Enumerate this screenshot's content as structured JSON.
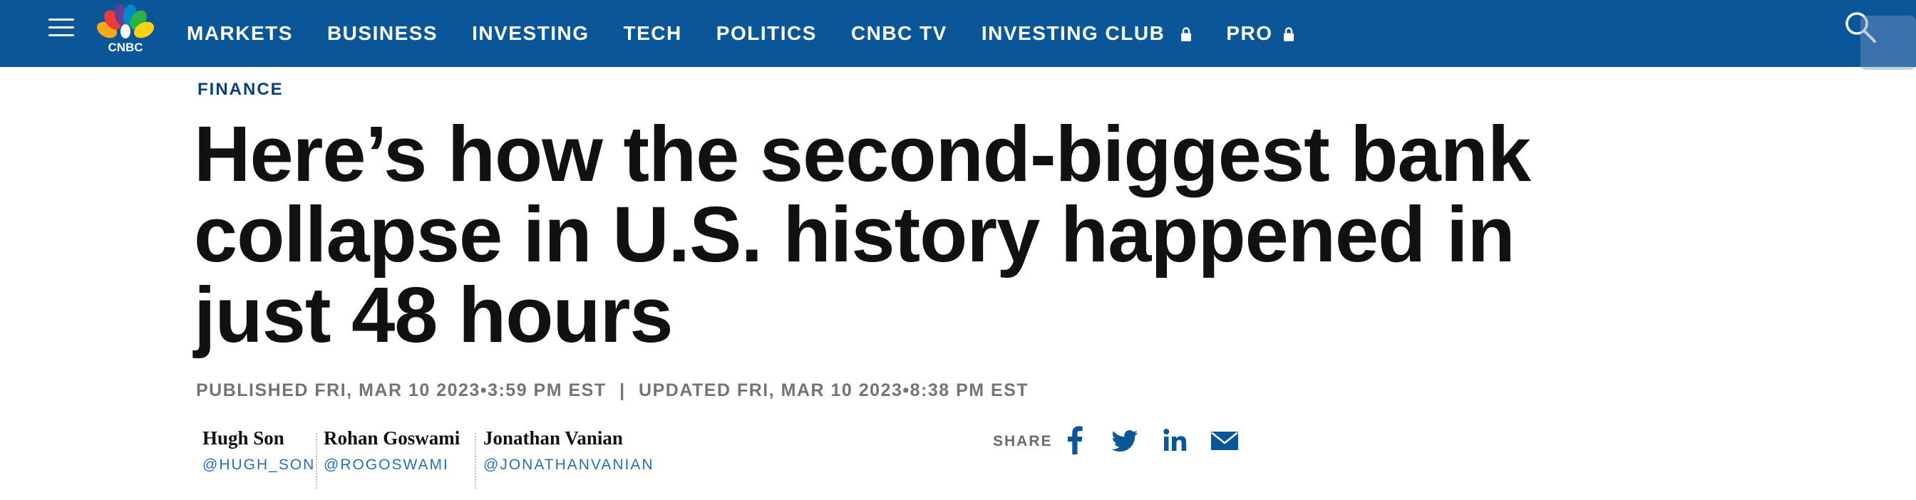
{
  "header": {
    "logo_text": "CNBC",
    "nav": [
      {
        "label": "MARKETS"
      },
      {
        "label": "BUSINESS"
      },
      {
        "label": "INVESTING"
      },
      {
        "label": "TECH"
      },
      {
        "label": "POLITICS"
      },
      {
        "label": "CNBC TV"
      },
      {
        "label": "INVESTING CLUB",
        "icon": "lock-icon"
      },
      {
        "label": "PRO",
        "icon": "lock-icon"
      }
    ],
    "search_icon": "search-icon",
    "menu_icon": "hamburger-menu-icon"
  },
  "article": {
    "section": "FINANCE",
    "headline": "Here’s how the second-biggest bank collapse in U.S. history happened in just 48 hours",
    "published": "PUBLISHED FRI, MAR 10 2023•3:59 PM EST",
    "separator": "|",
    "updated": "UPDATED FRI, MAR 10 2023•8:38 PM EST",
    "authors": [
      {
        "name": "Hugh Son",
        "handle": "@HUGH_SON"
      },
      {
        "name": "Rohan Goswami",
        "handle": "@ROGOSWAMI"
      },
      {
        "name": "Jonathan Vanian",
        "handle": "@JONATHANVANIAN"
      }
    ]
  },
  "share": {
    "label": "SHARE",
    "icons": [
      "facebook-icon",
      "twitter-icon",
      "linkedin-icon",
      "email-icon"
    ]
  },
  "colors": {
    "header_bg": "#0a5699",
    "section": "#0a3f7a",
    "share_icon": "#0a5699",
    "handle": "#2b6fb3"
  }
}
